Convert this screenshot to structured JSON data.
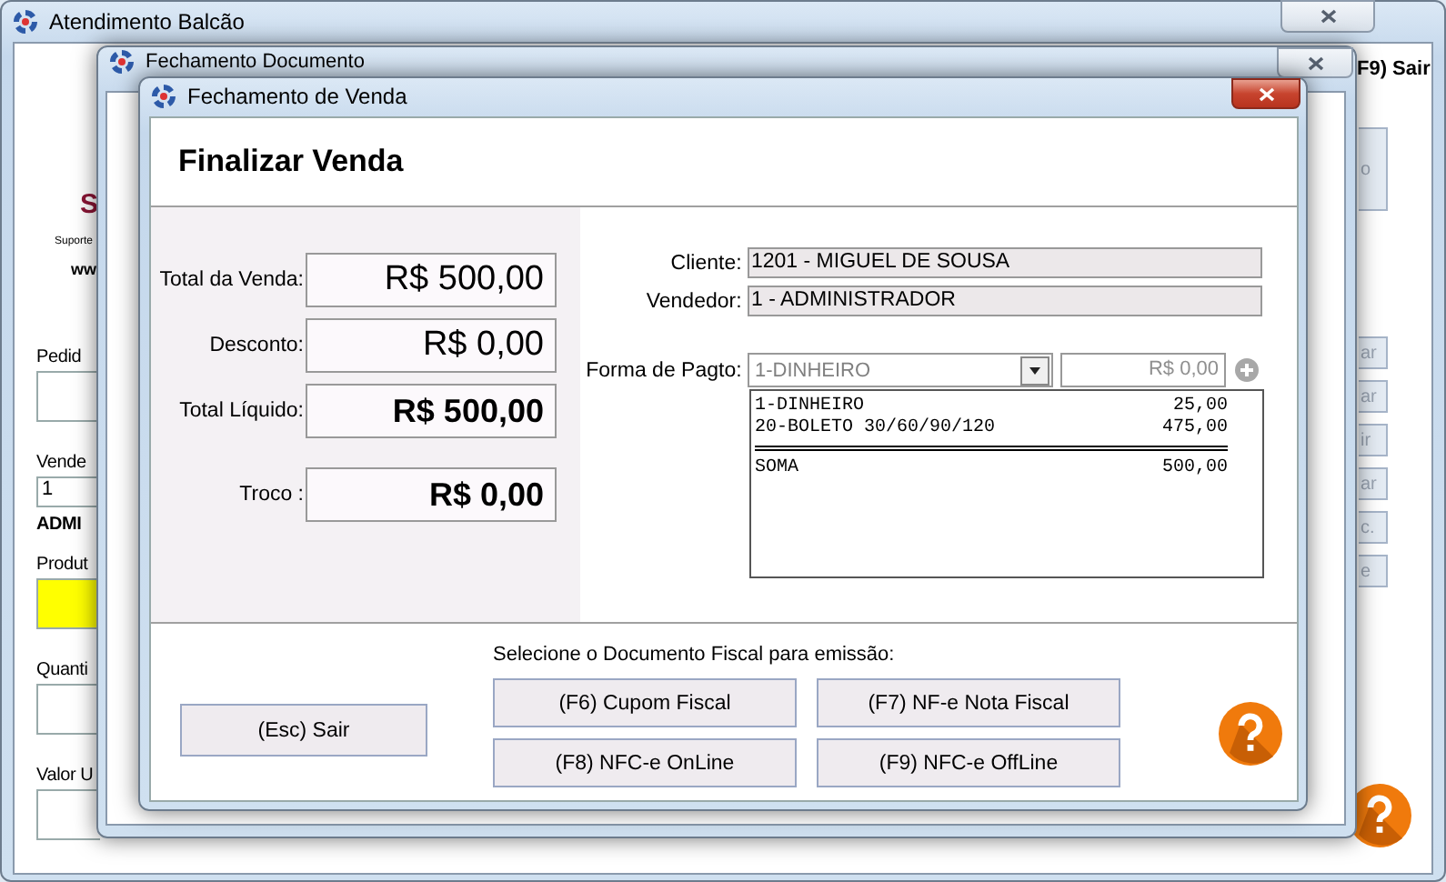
{
  "main_window": {
    "title": "Atendimento Balcão",
    "logo_letter": "S",
    "support_text": "Suporte",
    "site_text": "ww",
    "left_fields": [
      {
        "label": "Pedid",
        "kind": "field"
      },
      {
        "label": "Vende",
        "kind": "field",
        "value": "1"
      },
      {
        "label": "ADMI",
        "kind": "bold"
      },
      {
        "label": "Produt",
        "kind": "highlight"
      },
      {
        "label": "Quanti",
        "kind": "field"
      },
      {
        "label": "Valor U",
        "kind": "field"
      }
    ],
    "exit_label": "F9) Sair",
    "side_buttons": [
      "o",
      "ar",
      "ar",
      "ir",
      "ar",
      "c.",
      "e"
    ]
  },
  "document_window": {
    "title": "Fechamento Documento"
  },
  "sale_window": {
    "title": "Fechamento de Venda",
    "heading": "Finalizar Venda",
    "totals": [
      {
        "label": "Total da Venda:",
        "value": "R$ 500,00",
        "kind": "normal"
      },
      {
        "label": "Desconto:",
        "value": "R$ 0,00",
        "kind": "normal"
      },
      {
        "label": "Total Líquido:",
        "value": "R$ 500,00",
        "kind": "bold"
      },
      {
        "label": "Troco :",
        "value": "R$ 0,00",
        "kind": "bold"
      }
    ],
    "info": [
      {
        "label": "Cliente:",
        "value": "1201 - MIGUEL DE SOUSA"
      },
      {
        "label": "Vendedor:",
        "value": "1 - ADMINISTRADOR"
      }
    ],
    "payment": {
      "label": "Forma de Pagto:",
      "method": "1-DINHEIRO",
      "amount": "R$ 0,00"
    },
    "payments": [
      {
        "name": "1-DINHEIRO",
        "amount": "25,00"
      },
      {
        "name": "20-BOLETO 30/60/90/120",
        "amount": "475,00"
      }
    ],
    "payments_total": {
      "name": "SOMA",
      "amount": "500,00"
    },
    "exit_button": "(Esc) Sair",
    "fiscal_prompt": "Selecione o Documento Fiscal para emissão:",
    "fiscal_buttons": [
      "(F6) Cupom Fiscal",
      "(F7) NF-e Nota Fiscal",
      "(F8) NFC-e OnLine",
      "(F9) NFC-e OffLine"
    ]
  }
}
